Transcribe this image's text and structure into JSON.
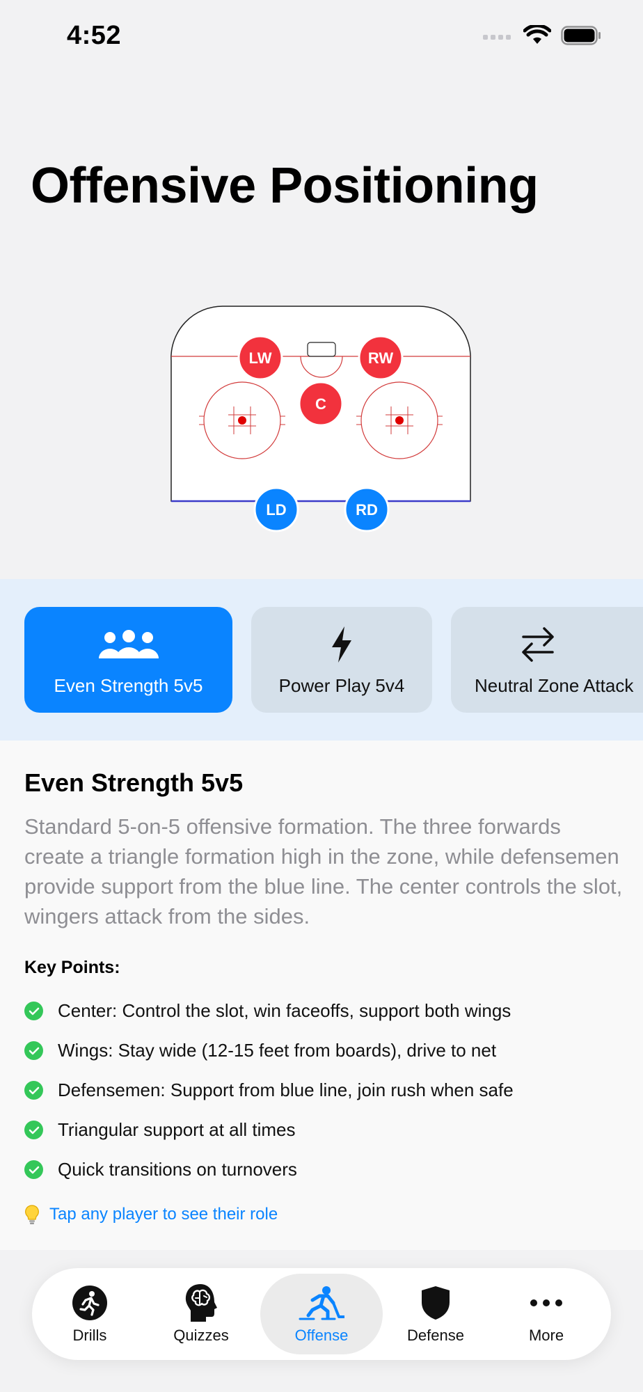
{
  "status_bar": {
    "time": "4:52"
  },
  "page": {
    "title": "Offensive Positioning"
  },
  "rink": {
    "players": [
      {
        "id": "lw",
        "label": "LW",
        "role": "forward"
      },
      {
        "id": "rw",
        "label": "RW",
        "role": "forward"
      },
      {
        "id": "c",
        "label": "C",
        "role": "forward"
      },
      {
        "id": "ld",
        "label": "LD",
        "role": "defense"
      },
      {
        "id": "rd",
        "label": "RD",
        "role": "defense"
      }
    ],
    "colors": {
      "forward": "#f2323d",
      "defense": "#0a84ff",
      "lines": "#d23b3b",
      "blue_line": "#3b3bc9"
    }
  },
  "scenarios": {
    "items": [
      {
        "label": "Even Strength 5v5",
        "icon": "people-group-icon",
        "selected": true
      },
      {
        "label": "Power Play 5v4",
        "icon": "lightning-bolt-icon",
        "selected": false
      },
      {
        "label": "Neutral Zone Attack",
        "icon": "arrows-left-right-icon",
        "selected": false
      }
    ]
  },
  "details": {
    "title": "Even Strength 5v5",
    "description": "Standard 5-on-5 offensive formation. The three forwards create a triangle formation high in the zone, while defensemen provide support from the blue line. The center controls the slot, wingers attack from the sides.",
    "key_points_title": "Key Points:",
    "key_points": [
      "Center: Control the slot, win faceoffs, support both wings",
      "Wings: Stay wide (12-15 feet from boards), drive to net",
      "Defensemen: Support from blue line, join rush when safe",
      "Triangular support at all times",
      "Quick transitions on turnovers"
    ],
    "tip": "Tap any player to see their role"
  },
  "tab_bar": {
    "items": [
      {
        "label": "Drills",
        "icon": "running-figure-icon",
        "active": false
      },
      {
        "label": "Quizzes",
        "icon": "brain-head-icon",
        "active": false
      },
      {
        "label": "Offense",
        "icon": "hockey-player-icon",
        "active": true
      },
      {
        "label": "Defense",
        "icon": "shield-icon",
        "active": false
      },
      {
        "label": "More",
        "icon": "ellipsis-icon",
        "active": false
      }
    ]
  },
  "colors": {
    "accent": "#0a84ff",
    "check_green": "#34c759",
    "secondary_text": "#8e8e93"
  }
}
